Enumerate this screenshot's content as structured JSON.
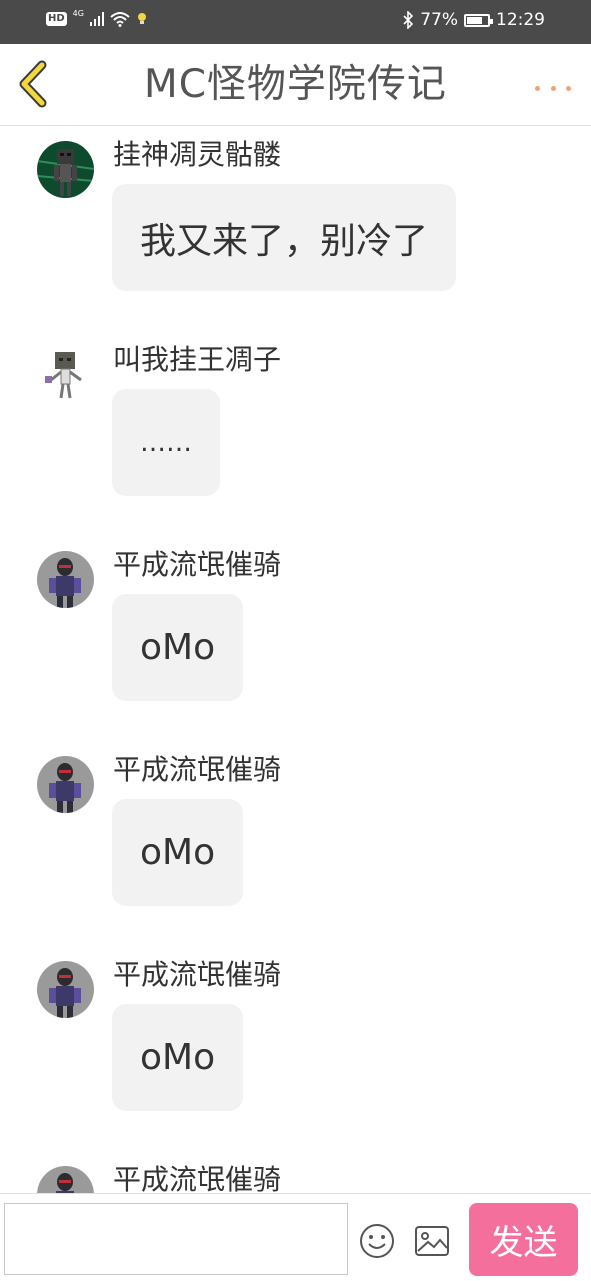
{
  "status_bar": {
    "hd": "HD",
    "network": "4G",
    "battery": "77%",
    "battery_level": 0.77,
    "time": "12:29"
  },
  "header": {
    "title": "MC怪物学院传记",
    "back_icon": "chevron-left-icon",
    "more_icon": "more-dots-icon",
    "accent_color": "#f0a277"
  },
  "messages": [
    {
      "sender": "挂神凋灵骷髅",
      "text": "我又来了，别冷了",
      "avatar": "wither-skeleton-avatar"
    },
    {
      "sender": "叫我挂王凋子",
      "text": "……",
      "avatar": "skeleton-avatar"
    },
    {
      "sender": "平成流氓催骑",
      "text": "oMo",
      "avatar": "rider-avatar"
    },
    {
      "sender": "平成流氓催骑",
      "text": "oMo",
      "avatar": "rider-avatar"
    },
    {
      "sender": "平成流氓催骑",
      "text": "oMo",
      "avatar": "rider-avatar"
    },
    {
      "sender": "平成流氓催骑",
      "text": "",
      "avatar": "rider-avatar"
    }
  ],
  "input_bar": {
    "placeholder": "",
    "send_label": "发送",
    "send_color": "#f56f9c"
  }
}
